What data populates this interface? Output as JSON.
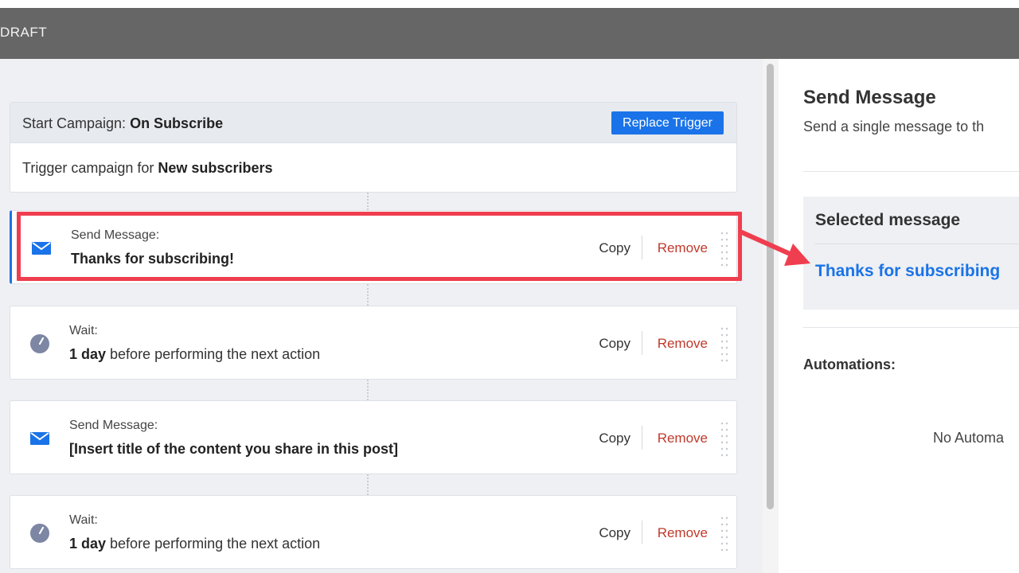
{
  "header": {
    "title": "DRAFT"
  },
  "trigger": {
    "head_prefix": "Start Campaign: ",
    "head_event": "On Subscribe",
    "replace_label": "Replace Trigger",
    "body_prefix": "Trigger campaign for ",
    "body_audience": "New subscribers"
  },
  "steps": [
    {
      "type": "send",
      "icon": "envelope-icon",
      "label": "Send Message:",
      "value": "Thanks for subscribing!",
      "copy": "Copy",
      "remove": "Remove",
      "selected": true
    },
    {
      "type": "wait",
      "icon": "clock-icon",
      "label": "Wait:",
      "value_strong": "1 day",
      "value_rest": " before performing the next action",
      "copy": "Copy",
      "remove": "Remove"
    },
    {
      "type": "send",
      "icon": "envelope-icon",
      "label": "Send Message:",
      "value": "[Insert title of the content you share in this post]",
      "copy": "Copy",
      "remove": "Remove"
    },
    {
      "type": "wait",
      "icon": "clock-icon",
      "label": "Wait:",
      "value_strong": "1 day",
      "value_rest": " before performing the next action",
      "copy": "Copy",
      "remove": "Remove"
    }
  ],
  "panel": {
    "title": "Send Message",
    "subtitle": "Send a single message to th",
    "selected_title": "Selected message",
    "selected_link": "Thanks for subscribing",
    "automations_label": "Automations:",
    "no_automations": "No Automa"
  },
  "colors": {
    "accent": "#1a73e8",
    "highlight": "#ef3e4f",
    "remove": "#c0392b",
    "header": "#666666"
  }
}
